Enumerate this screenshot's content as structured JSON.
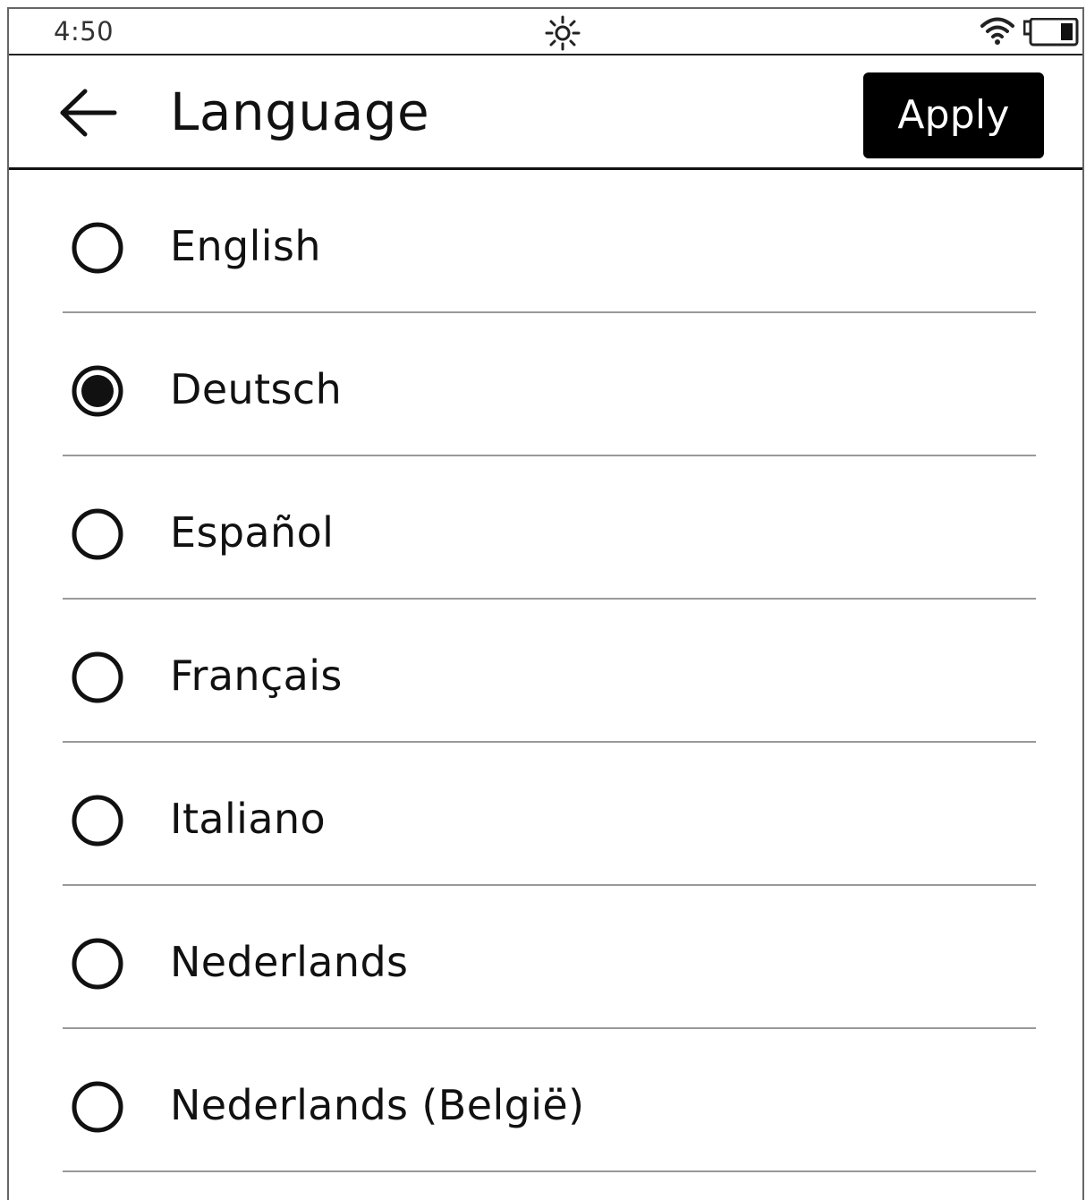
{
  "status_bar": {
    "time": "4:50",
    "sun_icon": "sun-icon",
    "wifi_icon": "wifi-icon",
    "battery_icon": "battery-icon"
  },
  "header": {
    "title": "Language",
    "apply_label": "Apply",
    "back_icon": "arrow-left-icon"
  },
  "languages": [
    {
      "label": "English",
      "selected": false
    },
    {
      "label": "Deutsch",
      "selected": true
    },
    {
      "label": "Español",
      "selected": false
    },
    {
      "label": "Français",
      "selected": false
    },
    {
      "label": "Italiano",
      "selected": false
    },
    {
      "label": "Nederlands",
      "selected": false
    },
    {
      "label": "Nederlands (België)",
      "selected": false
    }
  ],
  "colors": {
    "background": "#ffffff",
    "text": "#111111",
    "apply_button": "#000000",
    "apply_text": "#ffffff"
  }
}
